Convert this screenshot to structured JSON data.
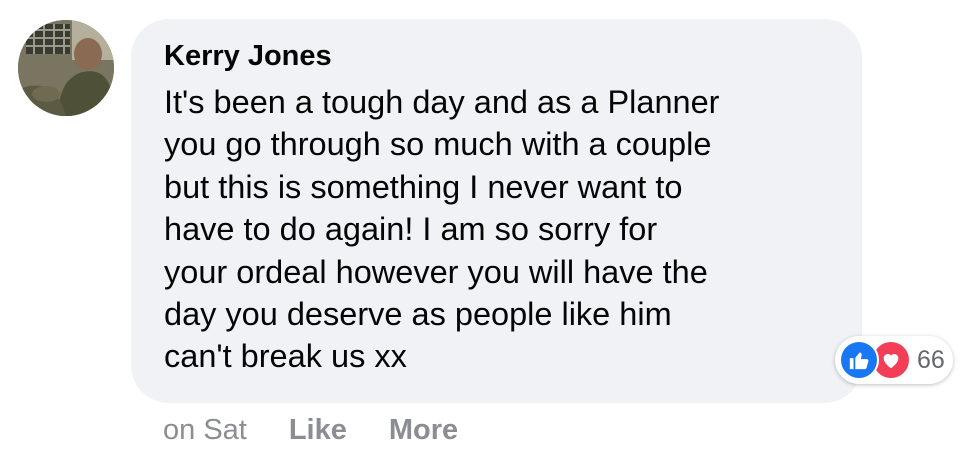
{
  "comment": {
    "author": "Kerry Jones",
    "lines": [
      "It's been a tough day and as a Planner",
      "you go through so much with a couple",
      "but this is something I never want to",
      "have to do again! I am so sorry for",
      "your ordeal however you will have the",
      "day you deserve as people like him",
      "can't break us xx"
    ],
    "reactions": {
      "icons": [
        "like-icon",
        "love-icon"
      ],
      "count": "66",
      "like_color": "#1877f2",
      "love_color": "#f33e58"
    },
    "actions": {
      "timestamp": "on Sat",
      "like_label": "Like",
      "more_label": "More"
    }
  }
}
